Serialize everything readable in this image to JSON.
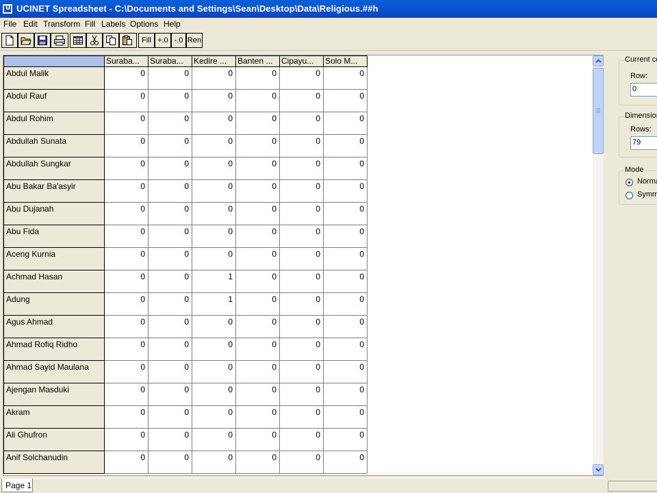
{
  "window": {
    "title": "UCINET Spreadsheet - C:\\Documents and Settings\\Sean\\Desktop\\Data\\Religious.##h"
  },
  "menu": [
    "File",
    "Edit",
    "Transform",
    "Fill",
    "Labels",
    "Options",
    "Help"
  ],
  "toolbar": {
    "icons": [
      "new-file-icon",
      "open-folder-icon",
      "save-icon",
      "print-icon",
      "grid-view-icon",
      "cut-icon",
      "copy-icon",
      "paste-icon"
    ],
    "fill_label": "Fill",
    "inc_decimal_label": "+.0",
    "dec_decimal_label": "-.0",
    "ren_label": "Ren"
  },
  "grid": {
    "columns": [
      "Suraba...",
      "Suraba...",
      "Kedire ...",
      "Banten ...",
      "Cipayu...",
      "Solo M..."
    ],
    "rows": [
      {
        "label": "Abdul Malik",
        "values": [
          "0",
          "0",
          "0",
          "0",
          "0",
          "0"
        ]
      },
      {
        "label": "Abdul Rauf",
        "values": [
          "0",
          "0",
          "0",
          "0",
          "0",
          "0"
        ]
      },
      {
        "label": "Abdul Rohim",
        "values": [
          "0",
          "0",
          "0",
          "0",
          "0",
          "0"
        ]
      },
      {
        "label": "Abdullah Sunata",
        "values": [
          "0",
          "0",
          "0",
          "0",
          "0",
          "0"
        ]
      },
      {
        "label": "Abdullah Sungkar",
        "values": [
          "0",
          "0",
          "0",
          "0",
          "0",
          "0"
        ]
      },
      {
        "label": "Abu Bakar Ba'asyir",
        "values": [
          "0",
          "0",
          "0",
          "0",
          "0",
          "0"
        ]
      },
      {
        "label": "Abu Dujanah",
        "values": [
          "0",
          "0",
          "0",
          "0",
          "0",
          "0"
        ]
      },
      {
        "label": "Abu Fida",
        "values": [
          "0",
          "0",
          "0",
          "0",
          "0",
          "0"
        ]
      },
      {
        "label": "Aceng Kurnia",
        "values": [
          "0",
          "0",
          "0",
          "0",
          "0",
          "0"
        ]
      },
      {
        "label": "Achmad Hasan",
        "values": [
          "0",
          "0",
          "1",
          "0",
          "0",
          "0"
        ]
      },
      {
        "label": "Adung",
        "values": [
          "0",
          "0",
          "1",
          "0",
          "0",
          "0"
        ]
      },
      {
        "label": "Agus Ahmad",
        "values": [
          "0",
          "0",
          "0",
          "0",
          "0",
          "0"
        ]
      },
      {
        "label": "Ahmad Rofiq Ridho",
        "values": [
          "0",
          "0",
          "0",
          "0",
          "0",
          "0"
        ]
      },
      {
        "label": "Ahmad Sayid Maulana",
        "values": [
          "0",
          "0",
          "0",
          "0",
          "0",
          "0"
        ]
      },
      {
        "label": "Ajengan Masduki",
        "values": [
          "0",
          "0",
          "0",
          "0",
          "0",
          "0"
        ]
      },
      {
        "label": "Akram",
        "values": [
          "0",
          "0",
          "0",
          "0",
          "0",
          "0"
        ]
      },
      {
        "label": "Ali Ghufron",
        "values": [
          "0",
          "0",
          "0",
          "0",
          "0",
          "0"
        ]
      },
      {
        "label": "Anif Solchanudin",
        "values": [
          "0",
          "0",
          "0",
          "0",
          "0",
          "0"
        ]
      }
    ]
  },
  "panel": {
    "current_cell": {
      "title": "Current ce",
      "row_label": "Row:",
      "row_value": "0"
    },
    "dimensions": {
      "title": "Dimension",
      "rows_label": "Rows:",
      "rows_value": "79"
    },
    "mode": {
      "title": "Mode",
      "options": [
        "Norma",
        "Symme"
      ],
      "selected": "Norma"
    }
  },
  "status": {
    "page_tab": "Page 1"
  }
}
